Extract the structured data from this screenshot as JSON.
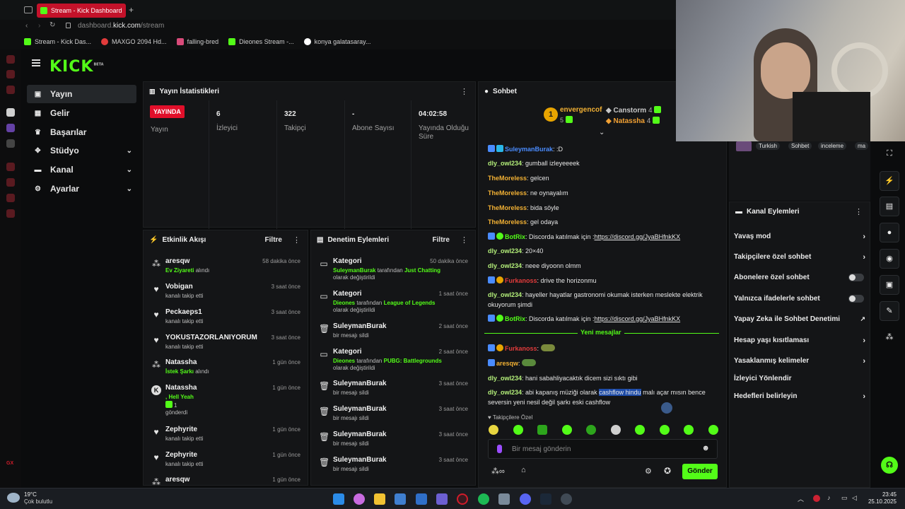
{
  "browser": {
    "tab_title": "Stream - Kick Dashboard",
    "url_prefix": "dashboard.",
    "url_domain": "kick.com",
    "url_path": "/stream",
    "bookmarks": [
      "Stream - Kick Das...",
      "MAXGO 2094 Hd...",
      "falling-bred",
      "Dieones Stream -...",
      "konya galatasaray..."
    ]
  },
  "logo": "KICK",
  "logo_sup": "BETA",
  "sidebar": {
    "items": [
      {
        "label": "Yayın",
        "icon": "broadcast-icon"
      },
      {
        "label": "Gelir",
        "icon": "revenue-icon"
      },
      {
        "label": "Başarılar",
        "icon": "trophy-icon"
      },
      {
        "label": "Stüdyo",
        "icon": "studio-icon"
      },
      {
        "label": "Kanal",
        "icon": "channel-icon"
      },
      {
        "label": "Ayarlar",
        "icon": "gear-icon"
      }
    ]
  },
  "stats": {
    "title": "Yayın İstatistikleri",
    "live_badge": "YAYINDA",
    "live_label": "Yayın",
    "viewers_value": "6",
    "viewers_label": "İzleyici",
    "followers_value": "322",
    "followers_label": "Takipçi",
    "subs_value": "-",
    "subs_label": "Abone Sayısı",
    "uptime_value": "04:02:58",
    "uptime_label": "Yayında Olduğu Süre"
  },
  "activity": {
    "title": "Etkinlik Akışı",
    "filter": "Filtre",
    "items": [
      {
        "name": "aresqw",
        "sub_green": "Ev Ziyareti",
        "sub": " alındı",
        "time": "58 dakika önce"
      },
      {
        "name": "Vobigan",
        "sub": "kanalı takip etti",
        "time": "3 saat önce"
      },
      {
        "name": "Peckaeps1",
        "sub": "kanalı takip etti",
        "time": "3 saat önce"
      },
      {
        "name": "YOKUSTAZORLANIYORUM",
        "sub": "kanalı takip etti",
        "time": "3 saat önce"
      },
      {
        "name": "Natassha",
        "sub_green": "İstek Şarkı",
        "sub": " alındı",
        "time": "1 gün önce"
      },
      {
        "name": "Natassha",
        "sub_green": ", Hell Yeah",
        "sub_extra": "1",
        "sub": "gönderdi",
        "time": "1 gün önce"
      },
      {
        "name": "Zephyrite",
        "sub": "kanalı takip etti",
        "time": "1 gün önce"
      },
      {
        "name": "Zephyrite",
        "sub": "kanalı takip etti",
        "time": "1 gün önce"
      },
      {
        "name": "aresqw",
        "sub": "",
        "time": "1 gün önce"
      }
    ]
  },
  "moderation": {
    "title": "Denetim Eylemleri",
    "filter": "Filtre",
    "items": [
      {
        "name": "Kategori",
        "actor": "SuleymanBurak",
        "mid": " tarafından ",
        "target": "Just Chatting",
        "end": " olarak değiştirildi",
        "time": "50 dakika önce"
      },
      {
        "name": "Kategori",
        "actor": "Dieones",
        "mid": " tarafından ",
        "target": "League of Legends",
        "end": "  olarak değiştirildi",
        "time": "1 saat önce"
      },
      {
        "name": "SuleymanBurak",
        "sub": "bir mesajı sildi",
        "time": "2 saat önce"
      },
      {
        "name": "Kategori",
        "actor": "Dieones",
        "mid": " tarafından ",
        "target": "PUBG: Battlegrounds",
        "end": " olarak değiştirildi",
        "time": "2 saat önce"
      },
      {
        "name": "SuleymanBurak",
        "sub": "bir mesajı sildi",
        "time": "3 saat önce"
      },
      {
        "name": "SuleymanBurak",
        "sub": "bir mesajı sildi",
        "time": "3 saat önce"
      },
      {
        "name": "SuleymanBurak",
        "sub": "bir mesajı sildi",
        "time": "3 saat önce"
      },
      {
        "name": "SuleymanBurak",
        "sub": "bir mesajı sildi",
        "time": "3 saat önce"
      }
    ]
  },
  "chat": {
    "title": "Sohbet",
    "top_gifter_1": "envergencof",
    "top_gifter_1_count": "5",
    "top_gifter_2": "Canstorm",
    "top_gifter_2_count": "4",
    "top_gifter_3": "Natassha",
    "top_gifter_3_count": "4",
    "rank_1": "1",
    "messages": [
      {
        "user": "SuleymanBurak",
        "color": "#4a8cff",
        "text": ":D"
      },
      {
        "user": "dly_owl234",
        "color": "#b4f07a",
        "text": "gumball izleyeeeek"
      },
      {
        "user": "TheMoreless",
        "color": "#f2b134",
        "text": "gelcen"
      },
      {
        "user": "TheMoreless",
        "color": "#f2b134",
        "text": "ne oynayalım"
      },
      {
        "user": "TheMoreless",
        "color": "#f2b134",
        "text": "bida söyle"
      },
      {
        "user": "TheMoreless",
        "color": "#f2b134",
        "text": "gel odaya"
      },
      {
        "user": "BotRix",
        "color": "#53fc18",
        "text": "Discorda katılmak için :",
        "link": "https://discord.gg/JyaBHfnkKX"
      },
      {
        "user": "dly_owl234",
        "color": "#b4f07a",
        "text": "20×40"
      },
      {
        "user": "dly_owl234",
        "color": "#b4f07a",
        "text": "neee diyoonn olmm"
      },
      {
        "user": "Furkanoss",
        "color": "#e23b3b",
        "text": "drive the horizonmu"
      },
      {
        "user": "dly_owl234",
        "color": "#b4f07a",
        "text": "hayeller hayatlar gastronomi okumak isterken meslekte elektrik okuyorum şimdi"
      },
      {
        "user": "BotRix",
        "color": "#53fc18",
        "text": "Discorda katılmak için :",
        "link": "https://discord.gg/JyaBHfnkKX"
      },
      {
        "user": "Furkanoss",
        "color": "#e23b3b",
        "text": ""
      },
      {
        "user": "aresqw",
        "color": "#f2b134",
        "text": ""
      },
      {
        "user": "dly_owl234",
        "color": "#b4f07a",
        "text": "hani sabahliyacaktık dicem sizi sıktı gibi"
      },
      {
        "user": "dly_owl234",
        "color": "#b4f07a",
        "text": "abi kapanış müziği olarak ",
        "highlight": "cashflow hindu",
        "after": " malı açar mısın bence seversin yeni nesil değil şarkı eski cashflow"
      }
    ],
    "new_messages": "Yeni mesajlar",
    "followers_only": "Takipçilere Özel",
    "input_placeholder": "Bir mesaj gönderin",
    "send": "Gönder"
  },
  "stream_tags": [
    "Turkish",
    "Sohbet",
    "inceleme",
    "ma"
  ],
  "channel_actions": {
    "title": "Kanal Eylemleri",
    "items": [
      {
        "label": "Yavaş mod",
        "control": "chevron"
      },
      {
        "label": "Takipçilere özel sohbet",
        "control": "chevron"
      },
      {
        "label": "Abonelere özel sohbet",
        "control": "toggle"
      },
      {
        "label": "Yalnızca ifadelerle sohbet",
        "control": "toggle"
      },
      {
        "label": "Yapay Zeka ile Sohbet Denetimi",
        "control": "external"
      },
      {
        "label": "Hesap yaşı kısıtlaması",
        "control": "chevron"
      },
      {
        "label": "Yasaklanmış kelimeler",
        "control": "chevron"
      },
      {
        "label": "İzleyici Yönlendir",
        "control": "none"
      },
      {
        "label": "Hedefleri belirleyin",
        "control": "chevron"
      }
    ]
  },
  "taskbar": {
    "weather_temp": "19°C",
    "weather_desc": "Çok bulutlu",
    "time": "23:45",
    "date": "25.10.2025",
    "sidebar_tag": "GX"
  },
  "colors": {
    "kick_green": "#53fc18",
    "live_red": "#e10f2a",
    "opera_red": "#d01c2a"
  }
}
